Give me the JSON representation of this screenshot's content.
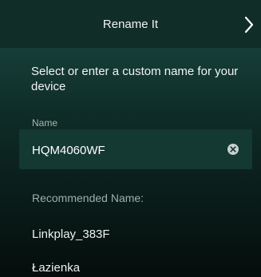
{
  "header": {
    "title": "Rename It",
    "next_icon": "chevron-right-icon"
  },
  "prompt": "Select or enter a custom name for your device",
  "name_field": {
    "label": "Name",
    "value": "HQM4060WF",
    "clear_icon": "clear-circle-icon"
  },
  "recommended": {
    "label": "Recommended Name:",
    "items": [
      "Linkplay_383F",
      "Łazienka"
    ]
  },
  "colors": {
    "header_bg": "#102d27",
    "field_bg": "#143832",
    "text": "#ffffff",
    "muted": "#a7b5b2"
  }
}
